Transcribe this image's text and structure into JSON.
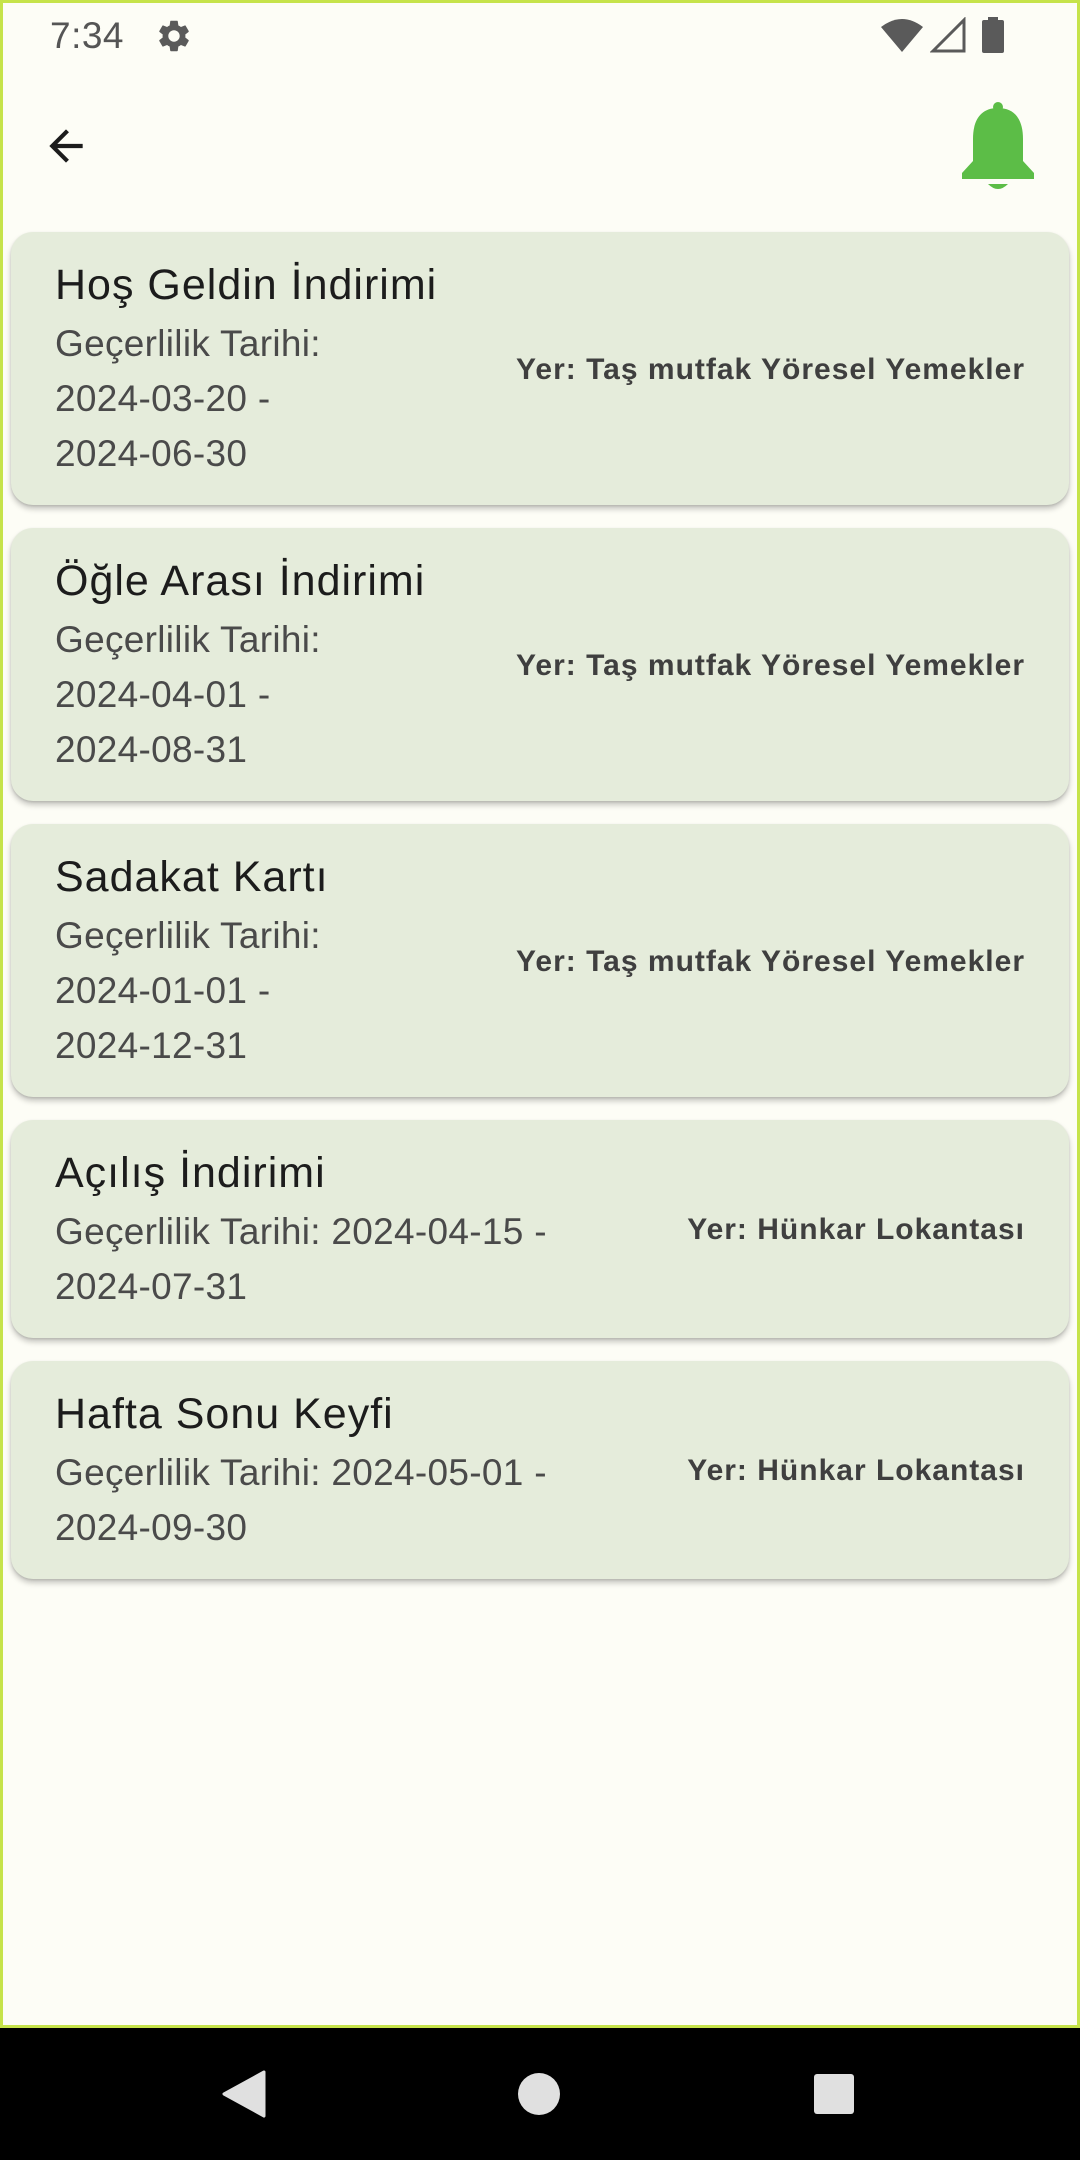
{
  "status_bar": {
    "time": "7:34",
    "icons": [
      "gear-icon",
      "wifi-icon",
      "signal-icon",
      "battery-icon"
    ]
  },
  "app_bar": {
    "back_icon": "arrow-left-icon",
    "notification_icon": "bell-icon",
    "accent_color": "#5cbd47"
  },
  "campaigns": [
    {
      "title": "Hoş Geldin İndirimi",
      "validity_lines": [
        "Geçerlilik Tarihi:",
        "2024-03-20 -",
        "2024-06-30"
      ],
      "place": "Yer: Taş mutfak Yöresel Yemekler"
    },
    {
      "title": "Öğle Arası İndirimi",
      "validity_lines": [
        "Geçerlilik Tarihi:",
        "2024-04-01 -",
        "2024-08-31"
      ],
      "place": "Yer: Taş mutfak Yöresel Yemekler"
    },
    {
      "title": "Sadakat Kartı",
      "validity_lines": [
        "Geçerlilik Tarihi:",
        "2024-01-01 -",
        "2024-12-31"
      ],
      "place": "Yer: Taş mutfak Yöresel Yemekler"
    },
    {
      "title": "Açılış İndirimi",
      "validity_lines": [
        "Geçerlilik Tarihi: 2024-04-15 -",
        "2024-07-31"
      ],
      "place": "Yer: Hünkar Lokantası"
    },
    {
      "title": "Hafta Sonu Keyfi",
      "validity_lines": [
        "Geçerlilik Tarihi: 2024-05-01 -",
        "2024-09-30"
      ],
      "place": "Yer: Hünkar Lokantası"
    }
  ],
  "nav_bar": {
    "icons": [
      "nav-back-icon",
      "nav-home-icon",
      "nav-recents-icon"
    ]
  }
}
